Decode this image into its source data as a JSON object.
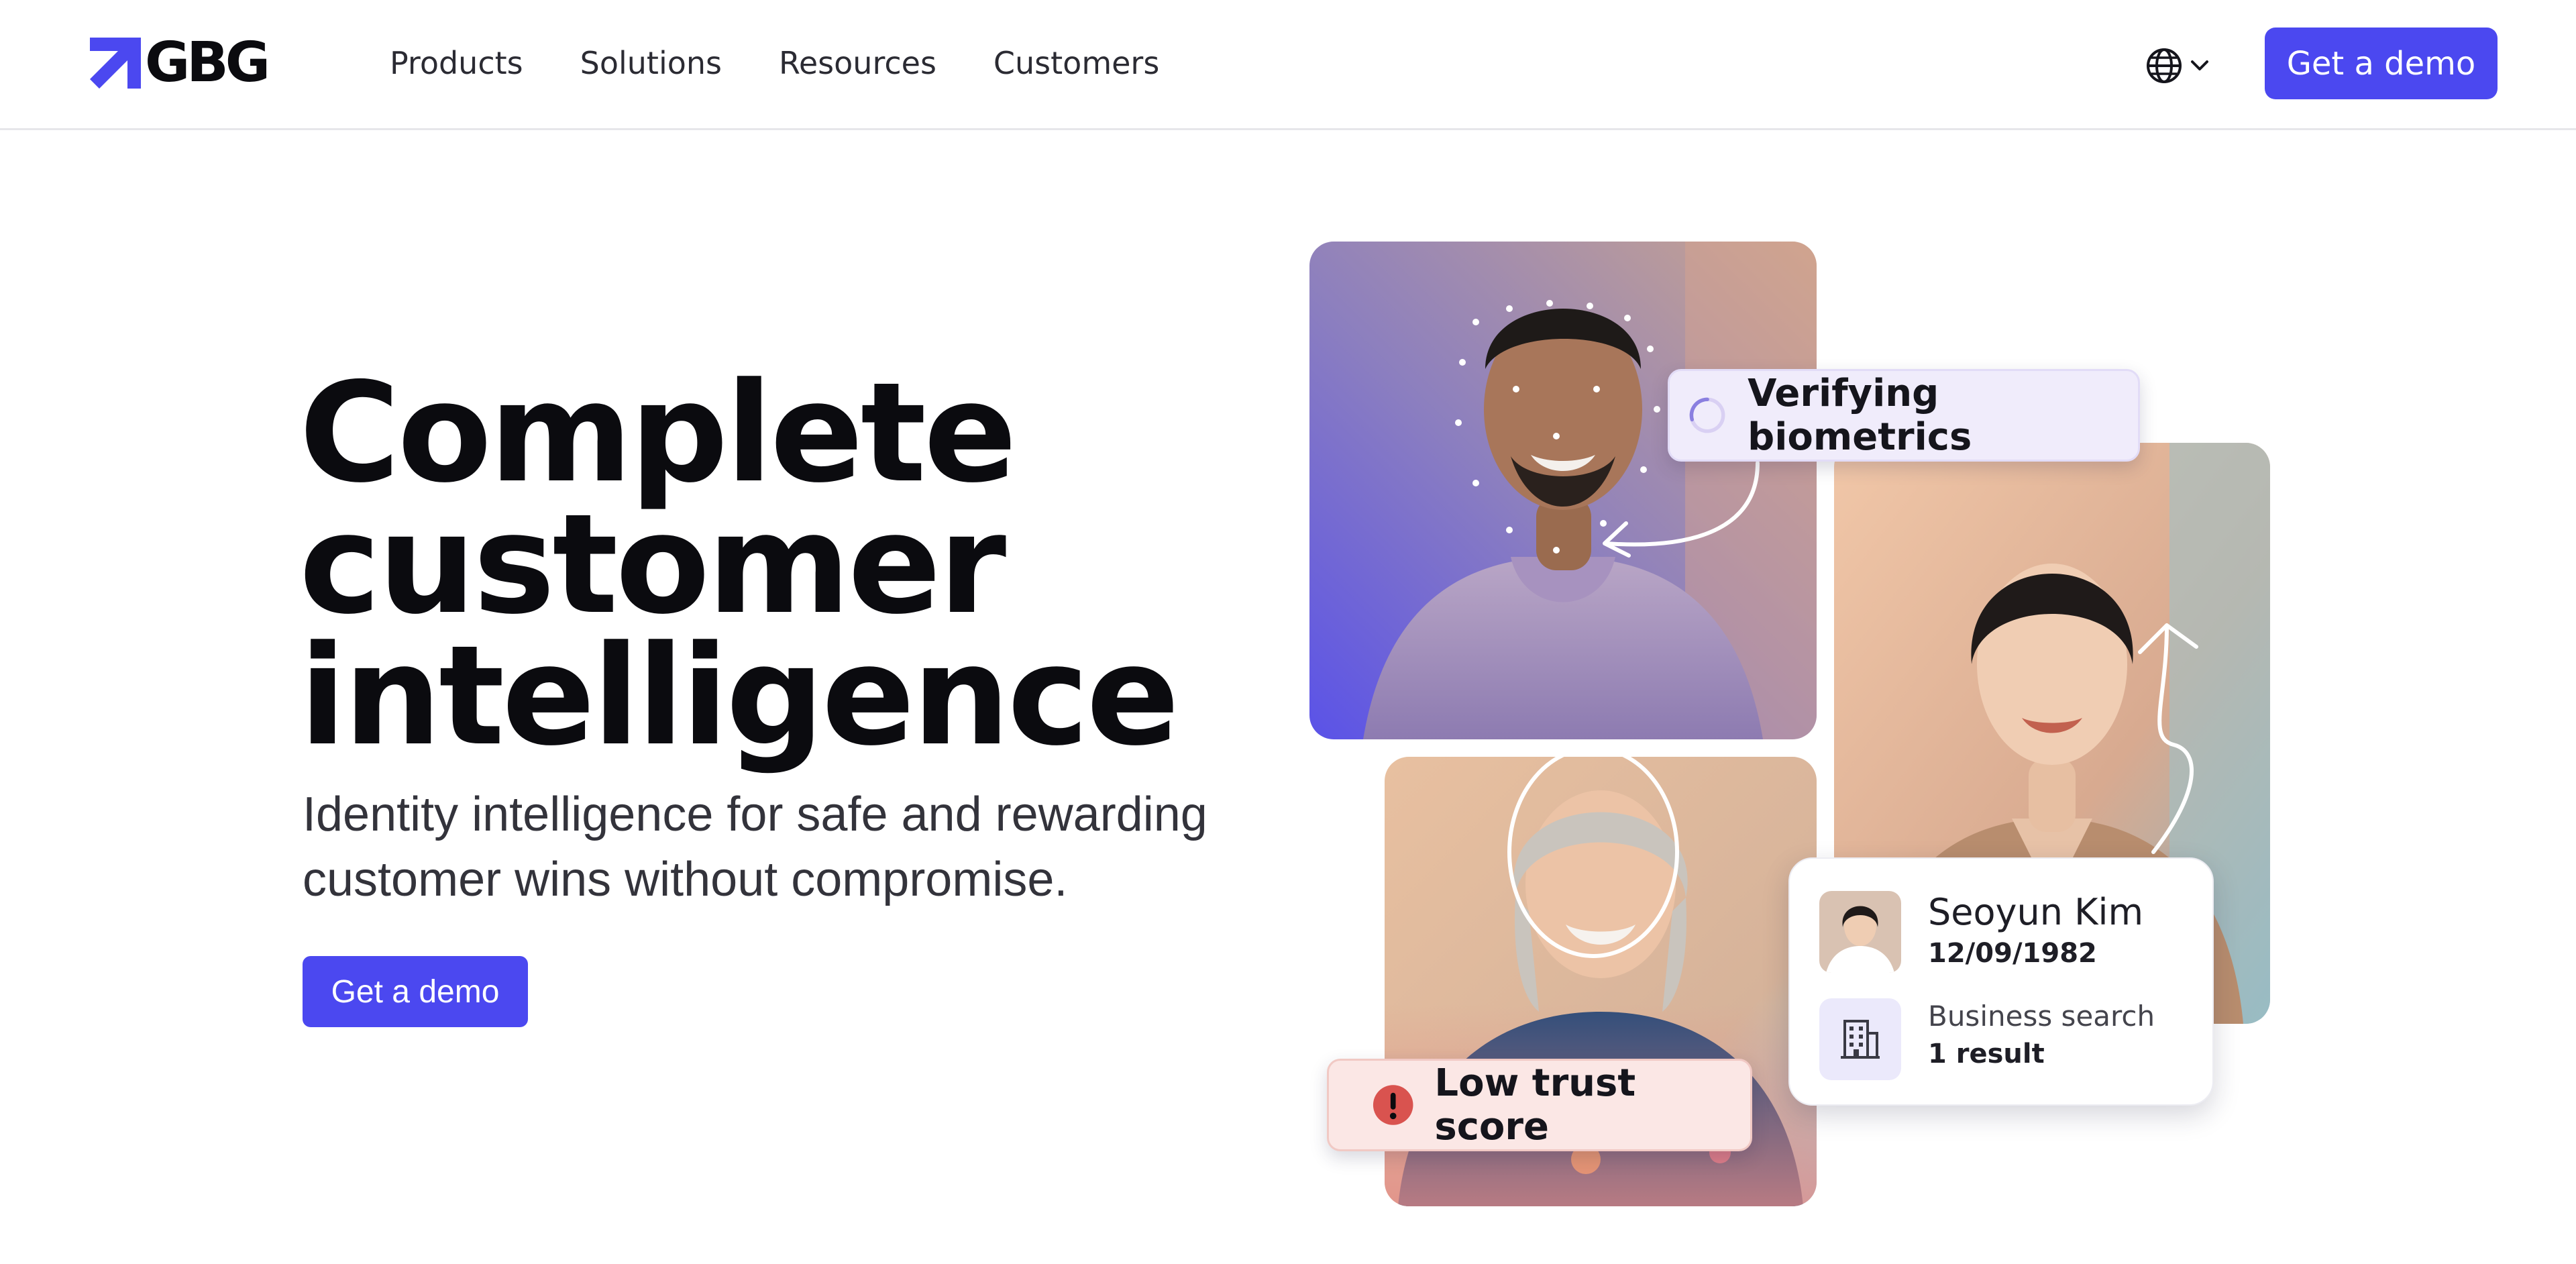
{
  "header": {
    "brand": "GBG",
    "logo_icon": "arrow-up-right-icon",
    "nav": [
      {
        "label": "Products"
      },
      {
        "label": "Solutions"
      },
      {
        "label": "Resources"
      },
      {
        "label": "Customers"
      }
    ],
    "language_icon": "globe-icon",
    "cta_label": "Get a demo"
  },
  "hero": {
    "title_lines": [
      "Complete",
      "customer",
      "intelligence"
    ],
    "subtitle": "Identity intelligence for safe and rewarding customer wins without compromise.",
    "cta_label": "Get a demo"
  },
  "collage": {
    "verify_chip": {
      "label": "Verifying biometrics",
      "icon": "spinner-icon"
    },
    "trust_chip": {
      "label": "Low trust score",
      "icon": "alert-icon"
    },
    "profile_card": {
      "name": "Seoyun Kim",
      "dob": "12/09/1982",
      "business_label": "Business search",
      "business_result": "1 result",
      "business_icon": "building-icon"
    }
  },
  "colors": {
    "accent": "#4b48f0",
    "text": "#0b0b0f",
    "verify_chip_bg": "#f0ecfb",
    "trust_chip_bg": "#fbe7e5",
    "alert": "#d9534f"
  }
}
